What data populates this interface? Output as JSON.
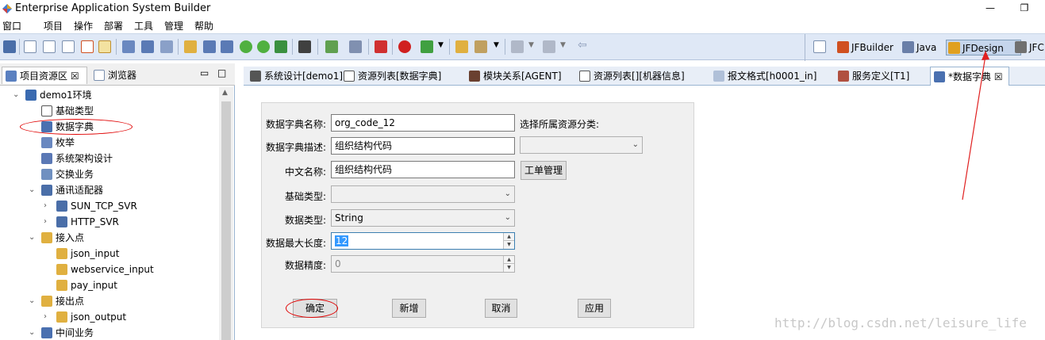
{
  "window": {
    "title": "Enterprise Application System Builder",
    "minimize": "—",
    "restore": "❐"
  },
  "menu": [
    "窗口",
    "项目",
    "操作",
    "部署",
    "工具",
    "管理",
    "帮助"
  ],
  "perspectives": [
    {
      "label": "JFBuilder",
      "icon": "jfbuilder-icon",
      "color": "#d05020"
    },
    {
      "label": "Java",
      "icon": "java-icon",
      "color": "#6a7fa8"
    },
    {
      "label": "JFDesign",
      "icon": "jfdesign-icon",
      "color": "#e0a020"
    },
    {
      "label": "JFC",
      "icon": "jfc-icon",
      "color": "#707070"
    }
  ],
  "left_panel": {
    "tabs": [
      {
        "label": "项目资源区 ☒",
        "icon": "project-resource-icon"
      },
      {
        "label": "浏览器",
        "icon": "browser-icon"
      }
    ],
    "minimize": "▭",
    "maximize": "□",
    "tree": [
      {
        "label": "demo1环境",
        "icon": "environment-icon",
        "expanded": true,
        "depth": 0
      },
      {
        "label": "基础类型",
        "icon": "base-type-icon",
        "depth": 1
      },
      {
        "label": "数据字典",
        "icon": "data-dictionary-icon",
        "depth": 1
      },
      {
        "label": "枚举",
        "icon": "enum-icon",
        "depth": 1
      },
      {
        "label": "系统架构设计",
        "icon": "architecture-icon",
        "depth": 1
      },
      {
        "label": "交换业务",
        "icon": "exchange-icon",
        "depth": 1
      },
      {
        "label": "通讯适配器",
        "icon": "adapter-icon",
        "expanded": true,
        "depth": 1
      },
      {
        "label": "SUN_TCP_SVR",
        "icon": "adapter-item-icon",
        "collapsed": true,
        "depth": 2
      },
      {
        "label": "HTTP_SVR",
        "icon": "adapter-item-icon",
        "collapsed": true,
        "depth": 2
      },
      {
        "label": "接入点",
        "icon": "folder-icon",
        "expanded": true,
        "depth": 1
      },
      {
        "label": "json_input",
        "icon": "folder-item-icon",
        "depth": 2
      },
      {
        "label": "webservice_input",
        "icon": "folder-item-icon",
        "depth": 2
      },
      {
        "label": "pay_input",
        "icon": "folder-item-icon",
        "depth": 2
      },
      {
        "label": "接出点",
        "icon": "folder-icon",
        "expanded": true,
        "depth": 1
      },
      {
        "label": "json_output",
        "icon": "folder-item-icon",
        "collapsed": true,
        "depth": 2
      },
      {
        "label": "中间业务",
        "icon": "middle-business-icon",
        "expanded": true,
        "depth": 1
      }
    ]
  },
  "editor_tabs": [
    {
      "label": "系统设计[demo1]",
      "icon": "system-design-icon"
    },
    {
      "label": "资源列表[数据字典]",
      "icon": "resource-list-icon"
    },
    {
      "label": "模块关系[AGENT]",
      "icon": "module-relation-icon"
    },
    {
      "label": "资源列表[][机器信息]",
      "icon": "resource-list-icon"
    },
    {
      "label": "报文格式[h0001_in]",
      "icon": "message-format-icon"
    },
    {
      "label": "服务定义[T1]",
      "icon": "service-definition-icon"
    },
    {
      "label": "*数据字典 ☒",
      "icon": "data-dictionary-icon"
    }
  ],
  "form": {
    "name_label": "数据字典名称:",
    "name_value": "org_code_12",
    "category_label": "选择所属资源分类:",
    "category_value": "",
    "desc_label": "数据字典描述:",
    "desc_value": "组织结构代码",
    "cn_label": "中文名称:",
    "cn_value": "组织结构代码",
    "ticket_button": "工单管理",
    "basetype_label": "基础类型:",
    "basetype_value": "",
    "datatype_label": "数据类型:",
    "datatype_value": "String",
    "maxlen_label": "数据最大长度:",
    "maxlen_value": "12",
    "precision_label": "数据精度:",
    "precision_value": "0",
    "buttons": {
      "ok": "确定",
      "add": "新增",
      "cancel": "取消",
      "apply": "应用"
    }
  },
  "watermark": "http://blog.csdn.net/leisure_life"
}
